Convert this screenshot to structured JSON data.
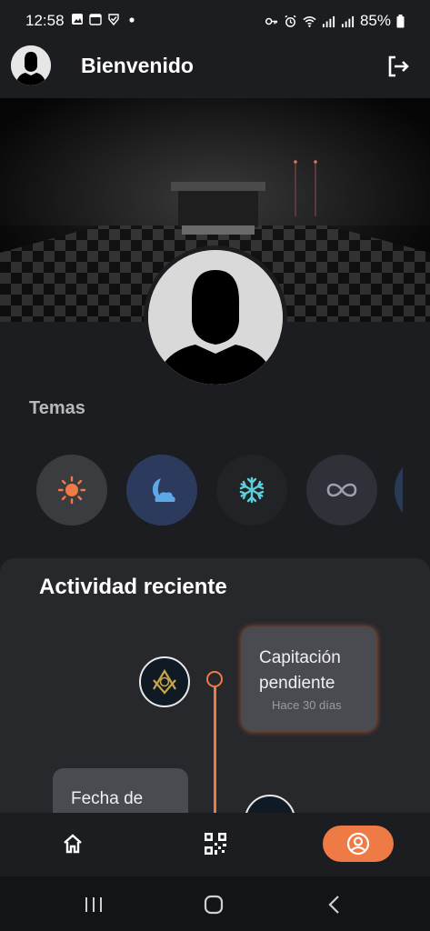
{
  "status_bar": {
    "time": "12:58",
    "battery": "85%",
    "left_icons": [
      "image-icon",
      "calendar-31-icon",
      "shield-check-icon",
      "dot-icon"
    ],
    "right_icons": [
      "key-icon",
      "alarm-icon",
      "wifi-icon",
      "signal-icon",
      "signal-icon",
      "battery-icon"
    ],
    "calendar_text": "31"
  },
  "app_bar": {
    "title": "Bienvenido",
    "avatar_icon": "user-silhouette-icon",
    "logout_icon": "logout-icon"
  },
  "themes": {
    "title": "Temas",
    "items": [
      {
        "name": "light",
        "icon": "sun-icon",
        "bg": "#3b3c40",
        "color": "#f07a45"
      },
      {
        "name": "night",
        "icon": "moon-cloud-icon",
        "bg": "#2c3a5e",
        "color": "#5ca8e8"
      },
      {
        "name": "ice",
        "icon": "snowflake-icon",
        "bg": "#222326",
        "color": "#5ad0dc"
      },
      {
        "name": "infinity",
        "icon": "infinity-icon",
        "bg": "#2f3038",
        "color": "#9aa0b0"
      }
    ]
  },
  "activity": {
    "title": "Actividad reciente",
    "events": [
      {
        "title": "Capitación pendiente",
        "time": "Hace 30 días"
      },
      {
        "title": "Fecha de",
        "time": ""
      }
    ]
  },
  "bottom_nav": {
    "items": [
      {
        "icon": "home-icon",
        "active": false
      },
      {
        "icon": "qr-code-icon",
        "active": false
      },
      {
        "icon": "profile-icon",
        "active": true
      }
    ]
  },
  "colors": {
    "accent": "#ee7a45",
    "background": "#1c1d20",
    "card": "#27282c"
  }
}
